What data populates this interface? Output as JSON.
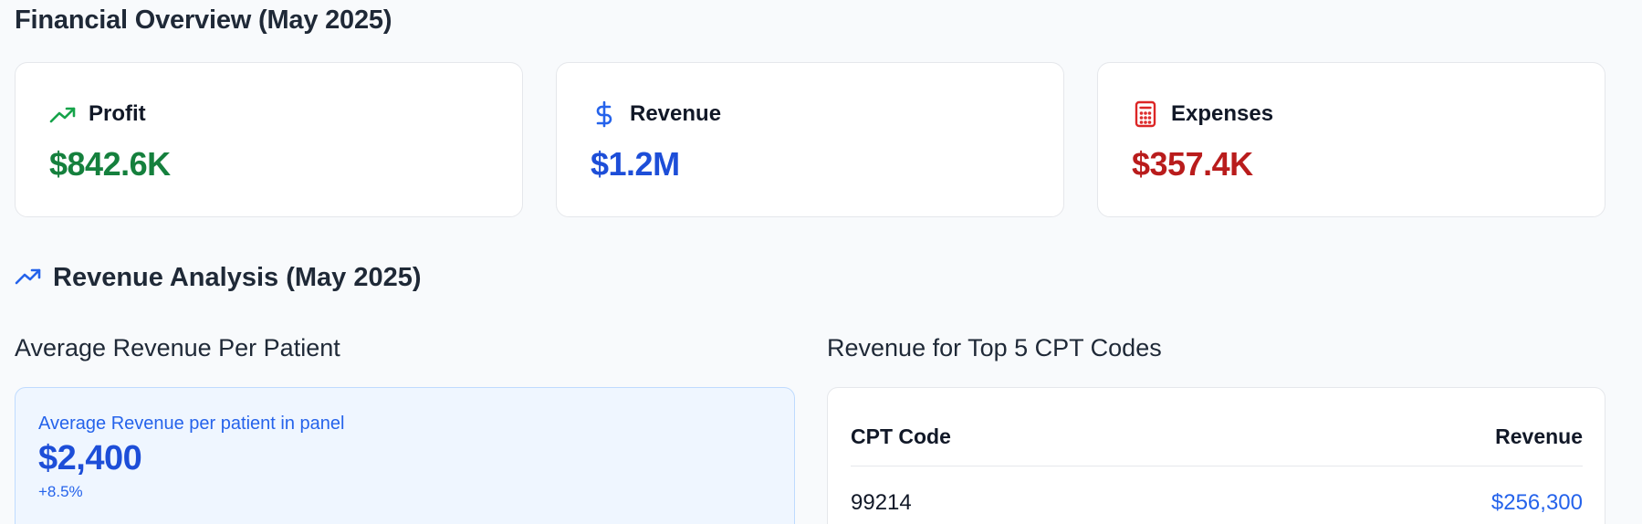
{
  "overview": {
    "title": "Financial Overview (May 2025)",
    "cards": [
      {
        "label": "Profit",
        "value": "$842.6K",
        "icon": "trending-up-icon",
        "color": "#15803d",
        "icon_color": "#16a34a"
      },
      {
        "label": "Revenue",
        "value": "$1.2M",
        "icon": "dollar-sign-icon",
        "color": "#1d4ed8",
        "icon_color": "#2563eb"
      },
      {
        "label": "Expenses",
        "value": "$357.4K",
        "icon": "calculator-icon",
        "color": "#b91c1c",
        "icon_color": "#dc2626"
      }
    ]
  },
  "revenue_analysis": {
    "title": "Revenue Analysis (May 2025)",
    "icon": "trending-up-icon",
    "icon_color": "#2563eb",
    "avg_section": {
      "title": "Average Revenue Per Patient",
      "caption": "Average Revenue per patient in panel",
      "value": "$2,400",
      "change": "+8.5%"
    },
    "cpt_section": {
      "title": "Revenue for Top 5 CPT Codes",
      "columns": [
        "CPT Code",
        "Revenue"
      ],
      "rows": [
        {
          "code": "99214",
          "revenue": "$256,300"
        }
      ]
    }
  }
}
